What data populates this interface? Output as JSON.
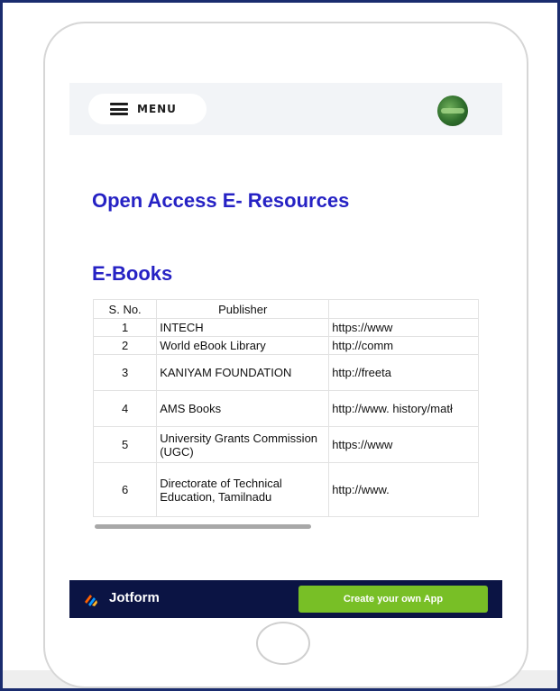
{
  "header": {
    "menu_label": "MENU",
    "avatar_icon": "profile-image-icon"
  },
  "page": {
    "title": "Open Access E- Resources",
    "section_title": "E-Books"
  },
  "table": {
    "headers": [
      "S. No.",
      "Publisher",
      ""
    ],
    "rows": [
      {
        "sno": "1",
        "publisher": "INTECH",
        "url": "https://www"
      },
      {
        "sno": "2",
        "publisher": "World eBook Library",
        "url": "http://comm"
      },
      {
        "sno": "3",
        "publisher": "KANIYAM FOUNDATION",
        "url": "http://freeta"
      },
      {
        "sno": "4",
        "publisher": "AMS Books",
        "url": "http://www. history/matł"
      },
      {
        "sno": "5",
        "publisher": "University Grants Commission (UGC)",
        "url": "https://www"
      },
      {
        "sno": "6",
        "publisher": "Directorate of Technical Education, Tamilnadu",
        "url": "http://www."
      }
    ]
  },
  "footer": {
    "brand": "Jotform",
    "cta": "Create your own App",
    "colors": {
      "bar": "#0b1444",
      "cta": "#78bf26"
    }
  },
  "colors": {
    "heading": "#2622c4",
    "frame_border": "#1a2c6e"
  }
}
